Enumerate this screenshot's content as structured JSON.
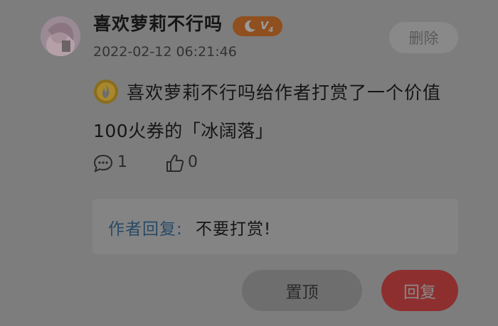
{
  "comment": {
    "username": "喜欢萝莉不行吗",
    "vip_level": "4",
    "timestamp": "2022-02-12 06:21:46",
    "delete_label": "删除",
    "message_line1": "喜欢萝莉不行吗给作者打赏了一个价值",
    "message_line2": "100火券的「冰阔落」",
    "comment_count": "1",
    "like_count": "0",
    "icons": [
      "avatar",
      "moon-icon",
      "fire-coin-icon",
      "comment-icon",
      "thumbs-up-icon"
    ]
  },
  "author_reply": {
    "label": "作者回复:",
    "text": "不要打赏!"
  },
  "actions": {
    "pin_label": "置顶",
    "reply_label": "回复"
  },
  "colors": {
    "overlay_bg": "#7d7d7d",
    "badge_orange": "#8f4f1e",
    "reply_red": "#8e2f2f",
    "author_blue": "#284a66"
  }
}
